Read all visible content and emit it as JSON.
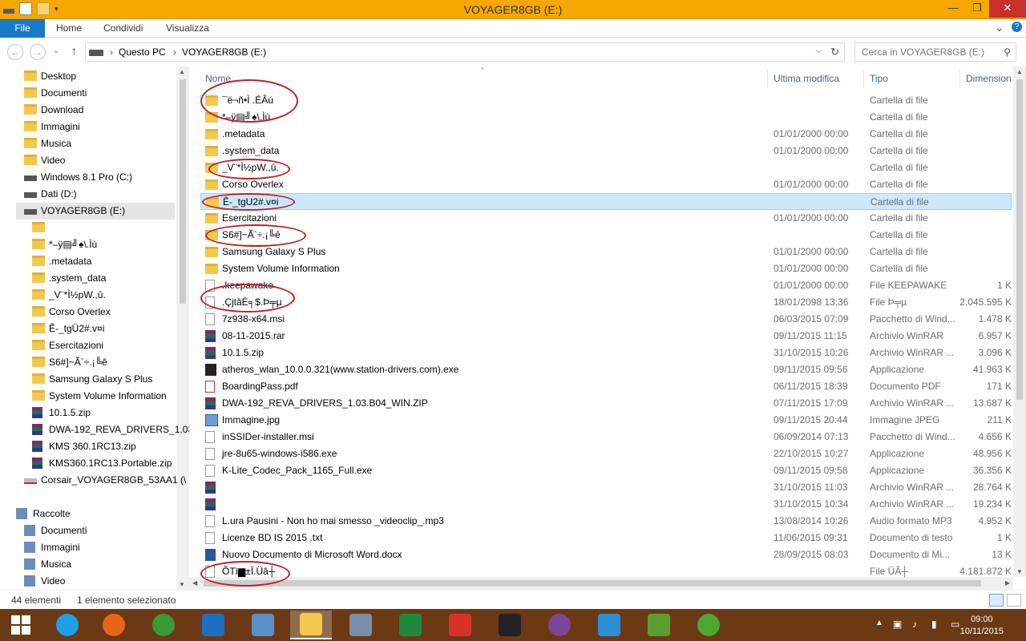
{
  "window": {
    "title": "VOYAGER8GB (E:)",
    "minimize": "—",
    "maximize": "❐",
    "close": "✕"
  },
  "ribbon": {
    "tabs": [
      "File",
      "Home",
      "Condividi",
      "Visualizza"
    ],
    "expand": "⌄",
    "help": "?"
  },
  "address": {
    "back": "←",
    "forward": "→",
    "recent": "⌄",
    "up": "↑",
    "crumbs": [
      "Questo PC",
      "VOYAGER8GB (E:)"
    ],
    "separator": "›",
    "search_placeholder": "Cerca in VOYAGER8GB (E:)"
  },
  "nav": {
    "items": [
      {
        "label": "Desktop",
        "icon": "desktop-folder-icon",
        "indent": 1
      },
      {
        "label": "Documenti",
        "icon": "documents-folder-icon",
        "indent": 1
      },
      {
        "label": "Download",
        "icon": "download-folder-icon",
        "indent": 1
      },
      {
        "label": "Immagini",
        "icon": "pictures-folder-icon",
        "indent": 1
      },
      {
        "label": "Musica",
        "icon": "music-folder-icon",
        "indent": 1
      },
      {
        "label": "Video",
        "icon": "video-folder-icon",
        "indent": 1
      },
      {
        "label": "Windows 8.1 Pro (C:)",
        "icon": "windows-drive-icon",
        "indent": 1
      },
      {
        "label": "Dati (D:)",
        "icon": "drive-icon",
        "indent": 1
      },
      {
        "label": "VOYAGER8GB (E:)",
        "icon": "usb-drive-icon",
        "indent": 1,
        "selected": true
      },
      {
        "label": "",
        "icon": "folder-icon",
        "indent": 2
      },
      {
        "label": "*–ÿ▤╝♠\\.Ìù",
        "icon": "folder-icon",
        "indent": 2
      },
      {
        "label": ".metadata",
        "icon": "folder-icon",
        "indent": 2
      },
      {
        "label": ".system_data",
        "icon": "folder-icon",
        "indent": 2
      },
      {
        "label": "_V¨*Ì½pW.,û.",
        "icon": "folder-icon",
        "indent": 2
      },
      {
        "label": "Corso Overlex",
        "icon": "folder-icon",
        "indent": 2
      },
      {
        "label": "Ê-_tgÜ2#.v¤i",
        "icon": "folder-icon",
        "indent": 2
      },
      {
        "label": "Esercitazioni",
        "icon": "folder-icon",
        "indent": 2
      },
      {
        "label": "S6#]~Ã`÷.¡╚ê",
        "icon": "folder-icon",
        "indent": 2
      },
      {
        "label": "Samsung Galaxy S Plus",
        "icon": "folder-icon",
        "indent": 2
      },
      {
        "label": "System Volume Information",
        "icon": "folder-icon",
        "indent": 2
      },
      {
        "label": "10.1.5.zip",
        "icon": "winrar-icon",
        "indent": 2
      },
      {
        "label": "DWA-192_REVA_DRIVERS_1.03",
        "icon": "winrar-icon",
        "indent": 2
      },
      {
        "label": "KMS 360.1RC13.zip",
        "icon": "winrar-icon",
        "indent": 2
      },
      {
        "label": "KMS360.1RC13.Portable.zip",
        "icon": "winrar-icon",
        "indent": 2
      },
      {
        "label": "Corsair_VOYAGER8GB_53AA1 (\\",
        "icon": "disconnected-drive-icon",
        "indent": 1
      },
      {
        "label": "Raccolte",
        "icon": "libraries-icon",
        "indent": 0
      },
      {
        "label": "Documenti",
        "icon": "documents-library-icon",
        "indent": 1
      },
      {
        "label": "Immagini",
        "icon": "pictures-library-icon",
        "indent": 1
      },
      {
        "label": "Musica",
        "icon": "music-library-icon",
        "indent": 1
      },
      {
        "label": "Video",
        "icon": "video-library-icon",
        "indent": 1
      }
    ]
  },
  "columns": {
    "name": "Nome",
    "modified": "Ultima modifica",
    "type": "Tipo",
    "size": "Dimension"
  },
  "files": [
    {
      "name": "¯ë¬ñ•Ì  .ÉÂú",
      "date": "",
      "type": "Cartella di file",
      "size": "",
      "icon": "folder-icon"
    },
    {
      "name": "*–ÿ▤╝♠\\.Ìù",
      "date": "",
      "type": "Cartella di file",
      "size": "",
      "icon": "folder-icon"
    },
    {
      "name": ".metadata",
      "date": "01/01/2000 00:00",
      "type": "Cartella di file",
      "size": "",
      "icon": "folder-icon"
    },
    {
      "name": ".system_data",
      "date": "01/01/2000 00:00",
      "type": "Cartella di file",
      "size": "",
      "icon": "folder-icon"
    },
    {
      "name": "_V¨*Ì½pW.,û.",
      "date": "",
      "type": "Cartella di file",
      "size": "",
      "icon": "folder-icon"
    },
    {
      "name": "Corso Overlex",
      "date": "01/01/2000 00:00",
      "type": "Cartella di file",
      "size": "",
      "icon": "folder-icon"
    },
    {
      "name": "Ê-_tgU2#.v¤i",
      "date": "",
      "type": "Cartella di file",
      "size": "",
      "icon": "folder-icon",
      "selected": true
    },
    {
      "name": "Esercitazioni",
      "date": "01/01/2000 00:00",
      "type": "Cartella di file",
      "size": "",
      "icon": "folder-icon"
    },
    {
      "name": "S6#]~Ã`÷.¡╚ê",
      "date": "",
      "type": "Cartella di file",
      "size": "",
      "icon": "folder-icon"
    },
    {
      "name": "Samsung Galaxy S Plus",
      "date": "01/01/2000 00:00",
      "type": "Cartella di file",
      "size": "",
      "icon": "folder-icon"
    },
    {
      "name": "System Volume Information",
      "date": "01/01/2000 00:00",
      "type": "Cartella di file",
      "size": "",
      "icon": "folder-icon"
    },
    {
      "name": ".keepawake",
      "date": "01/01/2000 00:00",
      "type": "File KEEPAWAKE",
      "size": "1 K",
      "icon": "file-icon"
    },
    {
      "name": ".ÇjtâÈ╕$.Þ╤µ",
      "date": "18/01/2098 13:36",
      "type": "File Þ╤µ",
      "size": "2.045.595 K",
      "icon": "file-icon"
    },
    {
      "name": "7z938-x64.msi",
      "date": "06/03/2015 07:09",
      "type": "Pacchetto di Wind...",
      "size": "1.478 K",
      "icon": "msi-icon"
    },
    {
      "name": "08-11-2015.rar",
      "date": "09/11/2015 11:15",
      "type": "Archivio WinRAR",
      "size": "6.957 K",
      "icon": "winrar-icon"
    },
    {
      "name": "10.1.5.zip",
      "date": "31/10/2015 10:26",
      "type": "Archivio WinRAR ...",
      "size": "3.096 K",
      "icon": "winrar-icon"
    },
    {
      "name": "atheros_wlan_10.0.0.321(www.station-drivers.com).exe",
      "date": "09/11/2015 09:56",
      "type": "Applicazione",
      "size": "41.963 K",
      "icon": "7z-exe-icon"
    },
    {
      "name": "BoardingPass.pdf",
      "date": "06/11/2015 18:39",
      "type": "Documento PDF",
      "size": "171 K",
      "icon": "pdf-icon"
    },
    {
      "name": "DWA-192_REVA_DRIVERS_1.03.B04_WIN.ZIP",
      "date": "07/11/2015 17:09",
      "type": "Archivio WinRAR ...",
      "size": "13.687 K",
      "icon": "winrar-icon"
    },
    {
      "name": "Immagine.jpg",
      "date": "09/11/2015 20:44",
      "type": "Immagine JPEG",
      "size": "211 K",
      "icon": "image-icon"
    },
    {
      "name": "inSSIDer-installer.msi",
      "date": "06/09/2014 07:13",
      "type": "Pacchetto di Wind...",
      "size": "4.656 K",
      "icon": "msi-icon"
    },
    {
      "name": "jre-8u65-windows-i586.exe",
      "date": "22/10/2015 10:27",
      "type": "Applicazione",
      "size": "48.956 K",
      "icon": "java-exe-icon"
    },
    {
      "name": "K-Lite_Codec_Pack_1165_Full.exe",
      "date": "09/11/2015 09:58",
      "type": "Applicazione",
      "size": "36.356 K",
      "icon": "klite-exe-icon"
    },
    {
      "name": "",
      "date": "31/10/2015 11:03",
      "type": "Archivio WinRAR ...",
      "size": "28.764 K",
      "icon": "winrar-icon"
    },
    {
      "name": "",
      "date": "31/10/2015 10:34",
      "type": "Archivio WinRAR ...",
      "size": "19.234 K",
      "icon": "winrar-icon"
    },
    {
      "name": "L.ura Pausini - Non ho mai smesso _videoclip_.mp3",
      "date": "13/08/2014 10:26",
      "type": "Audio formato MP3",
      "size": "4.952 K",
      "icon": "mp3-icon"
    },
    {
      "name": "Licenze BD IS 2015 .txt",
      "date": "11/06/2015 09:31",
      "type": "Documento di testo",
      "size": "1 K",
      "icon": "text-file-icon"
    },
    {
      "name": "Nuovo Documento di Microsoft Word.docx",
      "date": "28/09/2015 08:03",
      "type": "Documento di Mi...",
      "size": "13 K",
      "icon": "word-icon"
    },
    {
      "name": "ÕTì▆±Ï.Üâ┼",
      "date": "",
      "type": "File ÜÂ┼",
      "size": "4.181.872 K",
      "icon": "file-icon"
    }
  ],
  "status": {
    "count": "44 elementi",
    "selection": "1 elemento selezionato"
  },
  "taskbar": {
    "apps": [
      {
        "name": "start-button",
        "color": "#ffffff"
      },
      {
        "name": "internet-explorer-icon",
        "color": "#1ea0e6"
      },
      {
        "name": "firefox-icon",
        "color": "#e8641b"
      },
      {
        "name": "globe-icon",
        "color": "#3a9a3a"
      },
      {
        "name": "outlook-icon",
        "color": "#1f6fc2"
      },
      {
        "name": "network-icon",
        "color": "#5b8fc8"
      },
      {
        "name": "file-explorer-icon",
        "color": "#f2c94c"
      },
      {
        "name": "calculator-icon",
        "color": "#7b8ea8"
      },
      {
        "name": "excel-icon",
        "color": "#1e8a3c"
      },
      {
        "name": "acrobat-icon",
        "color": "#d7312a"
      },
      {
        "name": "star-app-icon",
        "color": "#222222"
      },
      {
        "name": "tor-browser-icon",
        "color": "#7d4698"
      },
      {
        "name": "box-app-icon",
        "color": "#2b8fd6"
      },
      {
        "name": "bitdefender-icon",
        "color": "#5a9e2f"
      },
      {
        "name": "utorrent-icon",
        "color": "#4aa832"
      }
    ],
    "time": "09:00",
    "date": "10/11/2015"
  },
  "colors": {
    "titlebar": "#f6a700",
    "file_tab": "#1979ca",
    "selection": "#cce8ff",
    "annotation": "#c0202a",
    "taskbar": "#6b3a14"
  }
}
